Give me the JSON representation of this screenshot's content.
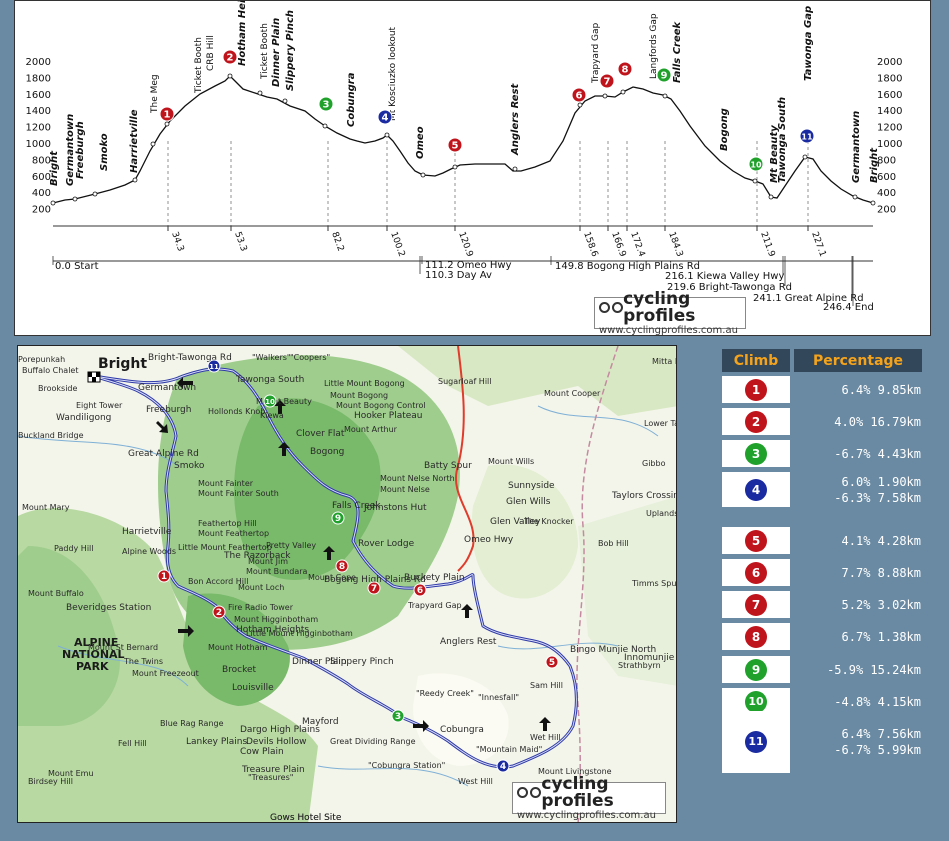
{
  "profile": {
    "elev_ticks": [
      "2000",
      "1800",
      "1600",
      "1400",
      "1200",
      "1000",
      "800",
      "600",
      "400",
      "200"
    ],
    "peak_labels": [
      {
        "t": "Bright",
        "bold": true,
        "italic": true
      },
      {
        "t": "Germantown",
        "bold": true,
        "italic": true
      },
      {
        "t": "Freeburgh",
        "bold": true,
        "italic": true
      },
      {
        "t": "Smoko",
        "bold": true,
        "italic": true
      },
      {
        "t": "Harrietville",
        "bold": true,
        "italic": true
      },
      {
        "t": "The Meg",
        "bold": false,
        "italic": false
      },
      {
        "t": "Ticket Booth",
        "bold": false,
        "italic": false
      },
      {
        "t": "CRB Hill",
        "bold": false,
        "italic": false
      },
      {
        "t": "Hotham Heights",
        "bold": true,
        "italic": true
      },
      {
        "t": "Ticket Booth",
        "bold": false,
        "italic": false
      },
      {
        "t": "Dinner Plain",
        "bold": true,
        "italic": true
      },
      {
        "t": "Slippery Pinch",
        "bold": true,
        "italic": true
      },
      {
        "t": "Cobungra",
        "bold": true,
        "italic": true
      },
      {
        "t": "Mt Kosciuzko lookout",
        "bold": false,
        "italic": false
      },
      {
        "t": "Omeo",
        "bold": true,
        "italic": true
      },
      {
        "t": "Anglers Rest",
        "bold": true,
        "italic": true
      },
      {
        "t": "Trapyard Gap",
        "bold": false,
        "italic": false
      },
      {
        "t": "Langfords Gap",
        "bold": false,
        "italic": false
      },
      {
        "t": "Falls Creek",
        "bold": true,
        "italic": true
      },
      {
        "t": "Bogong",
        "bold": true,
        "italic": true
      },
      {
        "t": "Mt Beauty",
        "bold": true,
        "italic": true
      },
      {
        "t": "Tawonga South",
        "bold": true,
        "italic": true
      },
      {
        "t": "Tawonga Gap",
        "bold": true,
        "italic": true
      },
      {
        "t": "Germantown",
        "bold": true,
        "italic": true
      },
      {
        "t": "Bright",
        "bold": true,
        "italic": true
      }
    ],
    "km_ticks": [
      "34.3",
      "53.3",
      "82.2",
      "100.2",
      "120.9",
      "158.6",
      "166.9",
      "172.4",
      "184.3",
      "211.9",
      "227.1"
    ],
    "waypoints": [
      "0.0 Start",
      "111.2 Omeo Hwy",
      "110.3 Day Av",
      "149.8 Bogong High Plains Rd",
      "216.1 Kiewa Valley Hwy",
      "219.6 Bright-Tawonga Rd",
      "241.1 Great Alpine Rd",
      "246.4 End"
    ],
    "logo": {
      "title": "cycling profiles",
      "url": "www.cyclingprofiles.com.au"
    }
  },
  "map": {
    "labels": [
      "Bright",
      "Bright-Tawonga Rd",
      "Tawonga South",
      "\"Walkers\"",
      "\"Coopers\"",
      "Little Mount Bogong",
      "Mount Bogong",
      "Mount Bogong Control",
      "Hooker Plateau",
      "Sugarloaf Hill",
      "Porepunkah",
      "Buffalo Chalet",
      "Brookside",
      "Germantown",
      "Eight Tower",
      "Wandiligong",
      "Freeburgh",
      "Buckland Bridge",
      "Great Alpine Rd",
      "Smoko",
      "Mount Mary",
      "Harrietville",
      "Feathertop Hill",
      "Paddy Hill",
      "Alpine Woods",
      "Mount Feathertop",
      "Little Mount Feathertop",
      "The Razorback",
      "Bon Accord Hill",
      "Beveridges Station",
      "Mount Buffalo",
      "ALPINE",
      "NATIONAL",
      "PARK",
      "Mount St Bernard",
      "The Twins",
      "Mount Freezeout",
      "Hotham Heights",
      "Mount Hotham",
      "Fire Radio Tower",
      "Brocket",
      "Louisville",
      "Mount Higginbotham",
      "Little Mount Higginbotham",
      "Dinner Plain",
      "Slippery Pinch",
      "Blue Rag Range",
      "Lankey Plains",
      "Dargo High Plains",
      "Devils Hollow",
      "Cow Plain",
      "Mayford",
      "Treasure Plain",
      "\"Treasures\"",
      "Gows Hotel Site",
      "Cobungra",
      "Fell Hill",
      "Birdsey Hill",
      "Gows Hotel Site",
      "Hollonds Knob",
      "Mount Emu",
      "Bogong High Plains Rd",
      "Falls Creek",
      "Johnstons Hut",
      "Rover Lodge",
      "Buckety Plain",
      "Trapyard Gap",
      "Anglers Rest",
      "Batty Spur",
      "Mount Wills",
      "Sunnyside",
      "Glen Wills",
      "Glen Valley",
      "The Knocker",
      "Omeo Hwy",
      "Mount Nelse",
      "Mount Nelse North",
      "Mount Cope",
      "Mount Loch",
      "Mount Jim",
      "Mount Bundara",
      "Clover Flat",
      "Bogong",
      "Kiewa",
      "Mount Beauty",
      "Mount Arthur",
      "Bingo Munjie North",
      "Innomunjie",
      "Strathbyrn",
      "Sam Hill",
      "\"Reedy Creek\"",
      "\"Innesfall\"",
      "\"Mountain Maid\"",
      "\"Cobungra Station\"",
      "West Hill",
      "Wet Hill",
      "Mount Livingstone",
      "Mount Cooper",
      "Lower Tableland",
      "Taylors Crossing",
      "Uplands",
      "Mitta Mitta",
      "Gibbo",
      "Bob Hill",
      "Mount Fainter",
      "Mount Fainter South",
      "Great Dividing Range",
      "Pretty Valley",
      "Timms Spur"
    ],
    "climb_markers": [
      "1",
      "2",
      "3",
      "4",
      "5",
      "6",
      "7",
      "8",
      "9",
      "10",
      "11"
    ],
    "logo": {
      "title": "cycling profiles",
      "url": "www.cyclingprofiles.com.au"
    }
  },
  "climbs": {
    "header_climb": "Climb",
    "header_pct": "Percentage",
    "rows": [
      {
        "num": "1",
        "color": "#c0141c",
        "lines": [
          "6.4% 9.85km"
        ]
      },
      {
        "num": "2",
        "color": "#c0141c",
        "lines": [
          "4.0% 16.79km"
        ]
      },
      {
        "num": "3",
        "color": "#1fa12b",
        "lines": [
          "-6.7% 4.43km"
        ]
      },
      {
        "num": "4",
        "color": "#1a2aa0",
        "lines": [
          "6.0% 1.90km",
          "-6.3% 7.58km"
        ]
      },
      {
        "num": "5",
        "color": "#c0141c",
        "lines": [
          "4.1% 4.28km"
        ]
      },
      {
        "num": "6",
        "color": "#c0141c",
        "lines": [
          "7.7% 8.88km"
        ]
      },
      {
        "num": "7",
        "color": "#c0141c",
        "lines": [
          "5.2% 3.02km"
        ]
      },
      {
        "num": "8",
        "color": "#c0141c",
        "lines": [
          "6.7% 1.38km"
        ]
      },
      {
        "num": "9",
        "color": "#1fa12b",
        "lines": [
          "-5.9% 15.24km"
        ]
      },
      {
        "num": "10",
        "color": "#1fa12b",
        "lines": [
          "-4.8% 4.15km"
        ]
      },
      {
        "num": "11",
        "color": "#1a2aa0",
        "lines": [
          "6.4% 7.56km",
          "-6.7% 5.99km"
        ]
      }
    ]
  },
  "colors": {
    "red": "#c0141c",
    "green": "#1fa12b",
    "blue": "#1a2aa0",
    "route": "#2f3aa8",
    "header_bg": "#33475b",
    "header_text": "#f5a31a",
    "page_bg": "#6a8aa3"
  }
}
